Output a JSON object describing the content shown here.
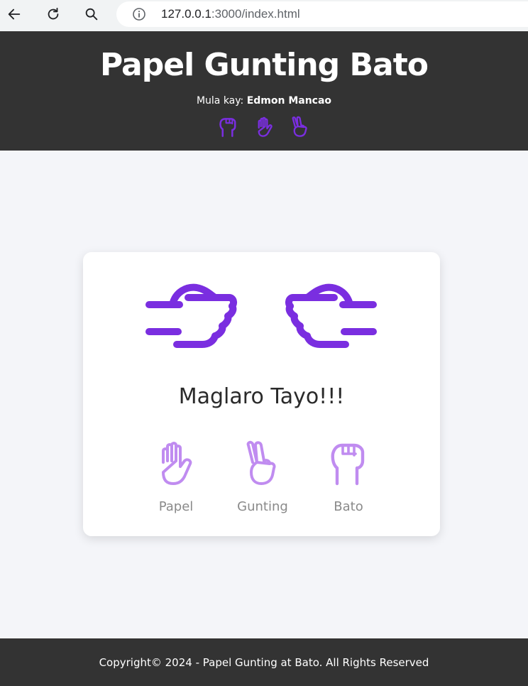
{
  "browser": {
    "url_host": "127.0.0.1",
    "url_rest": ":3000/index.html"
  },
  "header": {
    "title": "Papel Gunting Bato",
    "byline_prefix": "Mula kay: ",
    "byline_author": "Edmon Mancao",
    "icons": [
      "fist-icon",
      "open-hand-icon",
      "peace-hand-icon"
    ]
  },
  "game": {
    "player_hand": "fist-pointing-right-icon",
    "computer_hand": "fist-pointing-left-icon",
    "result_text": "Maglaro Tayo!!!",
    "choices": [
      {
        "label": "Papel",
        "icon": "open-hand-icon"
      },
      {
        "label": "Gunting",
        "icon": "peace-hand-icon"
      },
      {
        "label": "Bato",
        "icon": "fist-icon"
      }
    ]
  },
  "footer": {
    "text": "Copyright© 2024 - Papel Gunting at Bato. All Rights Reserved"
  },
  "colors": {
    "accent": "#7a2ee0",
    "accent_light": "#c08cf0",
    "dark": "#333333",
    "page_bg": "#f4f5f9"
  }
}
